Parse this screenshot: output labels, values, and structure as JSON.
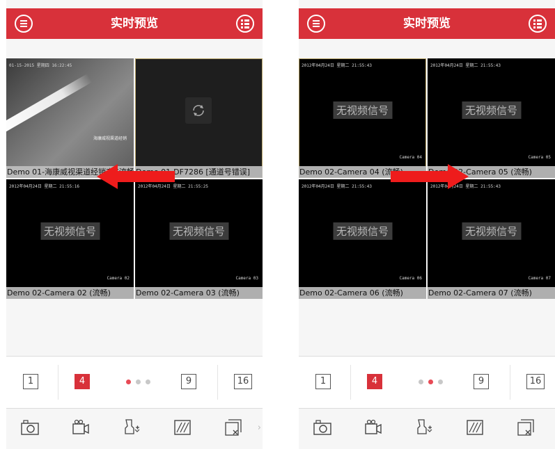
{
  "colors": {
    "accent": "#d8313a",
    "dot_active": "#e84a55",
    "tile_border": "#b9a56a"
  },
  "left_phone": {
    "header": {
      "title": "实时预览",
      "menu_icon": "menu-icon",
      "list_icon": "playlist-icon"
    },
    "tiles": [
      {
        "timestamp": "01-15-2015 星期四 16:22:45",
        "overlay": "海康威视渠道经销",
        "caption": "Demo 01-海康威视渠道经销商 (流畅)",
        "kind": "feed"
      },
      {
        "caption": "Demo 01-DF7286 [通道号错误]",
        "kind": "error",
        "icon": "reload-icon"
      },
      {
        "timestamp": "2012年04月24日 星期二 21:55:16",
        "no_video": "无视频信号",
        "camera": "Camera 02",
        "caption": "Demo 02-Camera 02 (流畅)",
        "kind": "novideo"
      },
      {
        "timestamp": "2012年04月24日 星期二 21:55:25",
        "no_video": "无视频信号",
        "camera": "Camera 03",
        "caption": "Demo 02-Camera 03 (流畅)",
        "kind": "novideo"
      }
    ],
    "split_buttons": [
      "1",
      "4",
      "9",
      "16"
    ],
    "active_split": "4",
    "page_dots": {
      "count": 3,
      "active": 0
    },
    "toolbar": [
      "camera-icon",
      "record-icon",
      "ptz-icon",
      "image-adjust-icon",
      "close-all-icon"
    ],
    "swipe_direction": "left"
  },
  "right_phone": {
    "header": {
      "title": "实时预览",
      "menu_icon": "menu-icon",
      "list_icon": "playlist-icon"
    },
    "tiles": [
      {
        "timestamp": "2012年04月24日 星期二 21:55:43",
        "no_video": "无视频信号",
        "camera": "Camera 04",
        "caption": "Demo 02-Camera 04 (流畅)",
        "kind": "novideo"
      },
      {
        "timestamp": "2012年04月24日 星期二 21:55:43",
        "no_video": "无视频信号",
        "camera": "Camera 05",
        "caption": "Demo 02-Camera 05 (流畅)",
        "kind": "novideo"
      },
      {
        "timestamp": "2012年04月24日 星期二 21:55:43",
        "no_video": "无视频信号",
        "camera": "Camera 06",
        "caption": "Demo 02-Camera 06 (流畅)",
        "kind": "novideo"
      },
      {
        "timestamp": "2012年04月24日 星期二 21:55:43",
        "no_video": "无视频信号",
        "camera": "Camera 07",
        "caption": "Demo 02-Camera 07 (流畅)",
        "kind": "novideo"
      }
    ],
    "split_buttons": [
      "1",
      "4",
      "9",
      "16"
    ],
    "active_split": "4",
    "page_dots": {
      "count": 3,
      "active": 1
    },
    "toolbar": [
      "camera-icon",
      "record-icon",
      "ptz-icon",
      "image-adjust-icon",
      "close-all-icon"
    ],
    "swipe_direction": "right"
  }
}
